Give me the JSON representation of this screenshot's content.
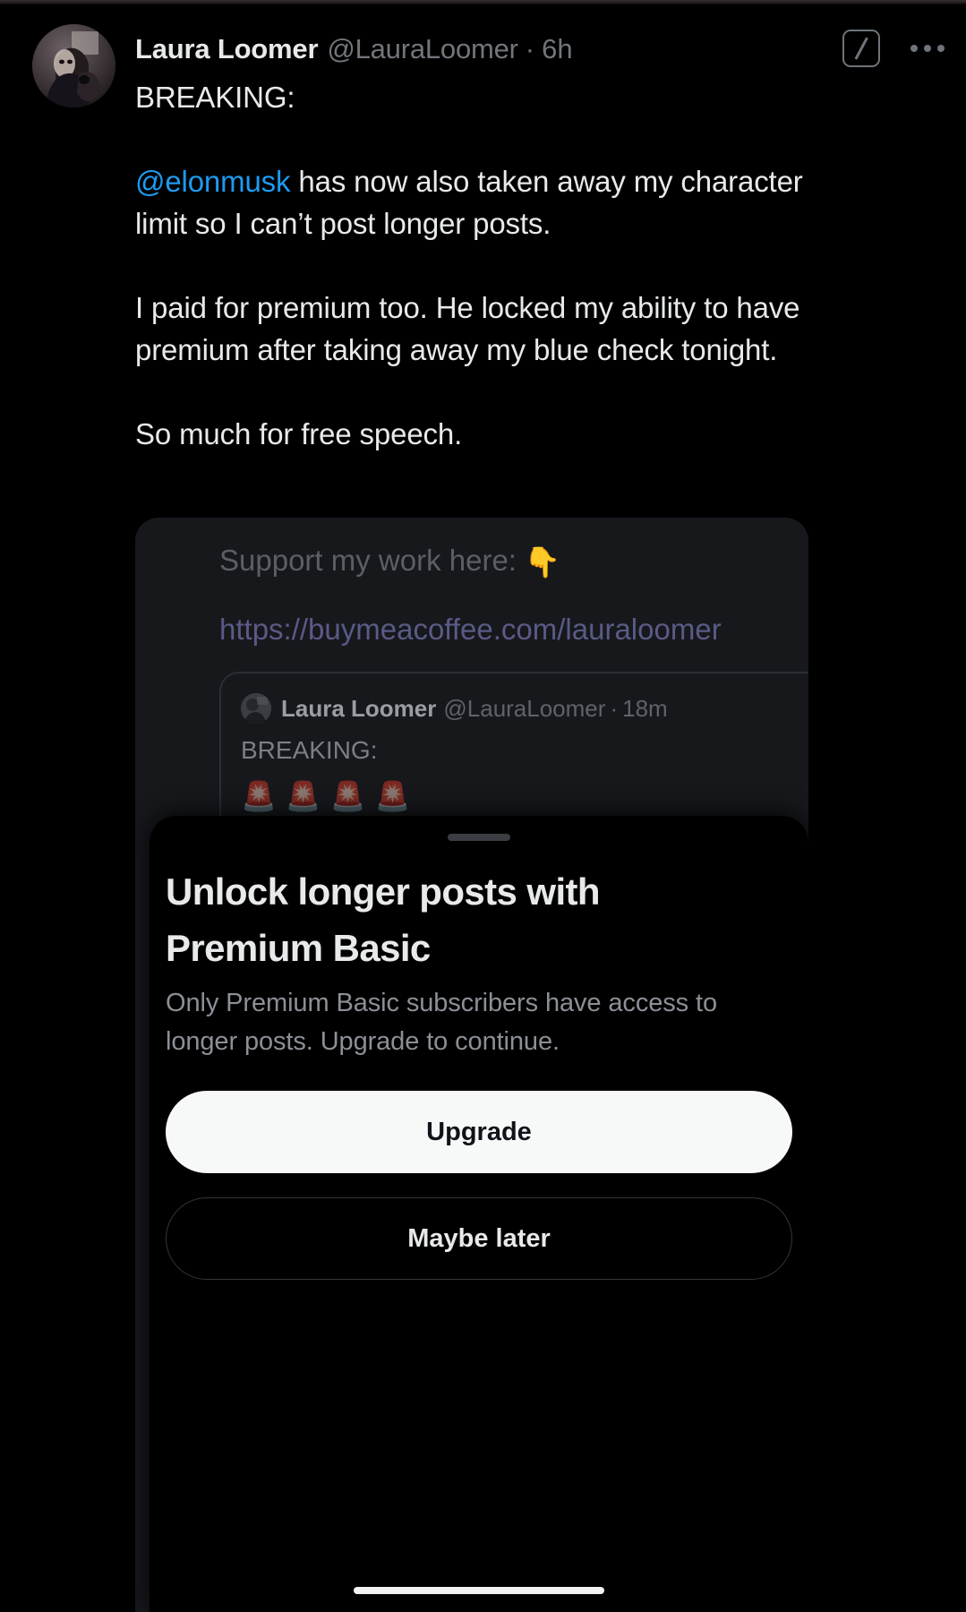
{
  "post": {
    "display_name": "Laura Loomer",
    "handle": "@LauraLoomer",
    "separator": "·",
    "timestamp": "6h",
    "body_line1": "BREAKING:",
    "mention": "@elonmusk",
    "body_after_mention": " has now also taken away my character limit so I can’t post longer posts.",
    "body_para2": "I paid for premium too. He locked my ability to have premium after taking away my blue check tonight.",
    "body_para3": "So much for free speech.",
    "actions": {
      "grok_icon": "grok-icon",
      "more_icon": "more-options-icon"
    },
    "avatar_icon": "avatar"
  },
  "screenshot_card": {
    "support_text": "Support my work here:",
    "pointing_emoji": "👇",
    "url": "https://buymeacoffee.com/lauraloomer",
    "quote": {
      "display_name": "Laura Loomer",
      "handle": "@LauraLoomer",
      "separator": "·",
      "timestamp": "18m",
      "text": "BREAKING:",
      "emojis": [
        "🚨",
        "🚨",
        "🚨",
        "🚨"
      ],
      "avatar_icon": "avatar"
    }
  },
  "sheet": {
    "grabber": "drag-handle",
    "title": "Unlock longer posts with Premium Basic",
    "description": "Only Premium Basic subscribers have access to longer posts. Upgrade to continue.",
    "primary_button": "Upgrade",
    "secondary_button": "Maybe later",
    "home_indicator": "home-indicator"
  },
  "colors": {
    "background": "#000000",
    "text_primary": "#e7e9ea",
    "text_muted": "#71767b",
    "link_blue": "#1d9bf0",
    "card_bg": "#16181c",
    "url_purple": "#5a5a86",
    "button_primary_bg": "#f7f9f9",
    "button_primary_text": "#0f1419"
  }
}
